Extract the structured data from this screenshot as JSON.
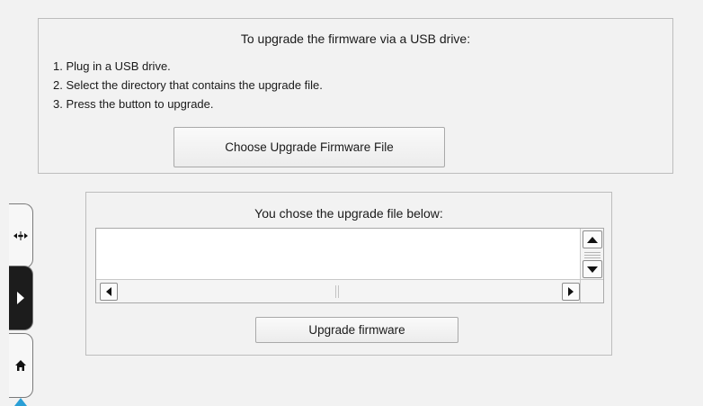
{
  "instructions": {
    "title": "To upgrade the firmware via a USB drive:",
    "steps": [
      "1. Plug in a USB drive.",
      "2. Select the directory that contains the upgrade file.",
      "3. Press the button to upgrade."
    ],
    "choose_button_label": "Choose Upgrade Firmware File"
  },
  "selection": {
    "title": "You chose the upgrade file below:",
    "file_path": "",
    "upgrade_button_label": "Upgrade firmware"
  },
  "side_tabs": [
    {
      "name": "network",
      "icon": "network-icon",
      "active": false
    },
    {
      "name": "play",
      "icon": "play-icon",
      "active": true
    },
    {
      "name": "home",
      "icon": "home-icon",
      "active": false
    }
  ],
  "colors": {
    "background": "#f2f2f2",
    "panel_border": "#bdbdbd",
    "active_tab": "#1c1c1c",
    "indicator": "#2a9fd6"
  }
}
